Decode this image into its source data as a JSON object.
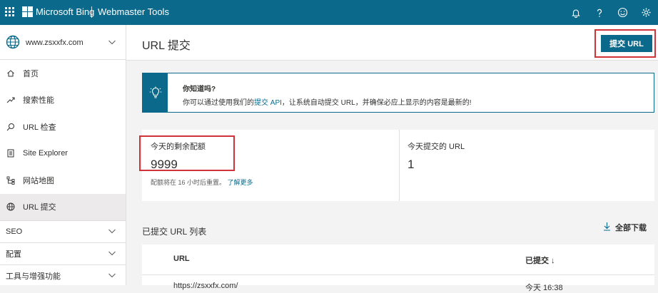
{
  "topbar": {
    "brand": "Microsoft Bing",
    "product": "Webmaster Tools",
    "icons": [
      "waffle-icon",
      "bell-icon",
      "help-icon",
      "smiley-icon",
      "gear-icon"
    ],
    "color": "#0b6a8c"
  },
  "sidebar": {
    "site": "www.zsxxfx.com",
    "items": [
      {
        "label": "首页",
        "icon": "home-icon"
      },
      {
        "label": "搜索性能",
        "icon": "trend-icon"
      },
      {
        "label": "URL 检查",
        "icon": "search-icon"
      },
      {
        "label": "Site Explorer",
        "icon": "document-icon"
      },
      {
        "label": "网站地图",
        "icon": "sitemap-icon"
      },
      {
        "label": "URL 提交",
        "icon": "globe-icon",
        "active": true
      }
    ],
    "groups": [
      "SEO",
      "配置",
      "工具与增强功能"
    ]
  },
  "header": {
    "title": "URL 提交",
    "submit_label": "提交 URL"
  },
  "banner": {
    "title": "你知道吗?",
    "text_pre": "你可以通过使用我们的",
    "link": "提交 API",
    "text_post": "，让系统自动提交 URL，并确保必应上显示的内容是最新的!"
  },
  "stats": {
    "quota_label": "今天的剩余配额",
    "quota_value": "9999",
    "quota_note": "配额将在 16 小时后重置。",
    "learn_more": "了解更多",
    "submitted_label": "今天提交的 URL",
    "submitted_value": "1"
  },
  "list": {
    "title": "已提交 URL 列表",
    "download_label": "全部下载",
    "col_url": "URL",
    "col_submitted": "已提交 ↓",
    "rows": [
      {
        "url": "https://zsxxfx.com/",
        "time": "今天 16:38"
      }
    ]
  },
  "accent": {
    "highlight": "#d13438",
    "link": "#0b6a8c"
  }
}
